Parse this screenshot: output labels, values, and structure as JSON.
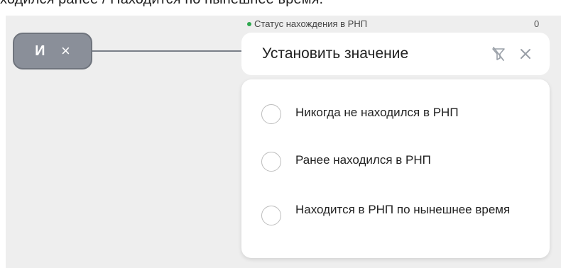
{
  "header": {
    "clipped_text": "ходился ранее / Находится по нынешнее время."
  },
  "operator_chip": {
    "label": "И",
    "close_glyph": "×"
  },
  "field": {
    "status_label": "Статус нахождения в РНП",
    "count": "0",
    "status_dot_color": "#2fa84f",
    "value_placeholder": "Установить значение",
    "icons": [
      "filter-off-icon",
      "close-icon"
    ]
  },
  "dropdown": {
    "options": [
      {
        "label": "Никогда не находился в РНП"
      },
      {
        "label": "Ранее находился в РНП"
      },
      {
        "label": "Находится в РНП по нынешнее время"
      }
    ]
  }
}
